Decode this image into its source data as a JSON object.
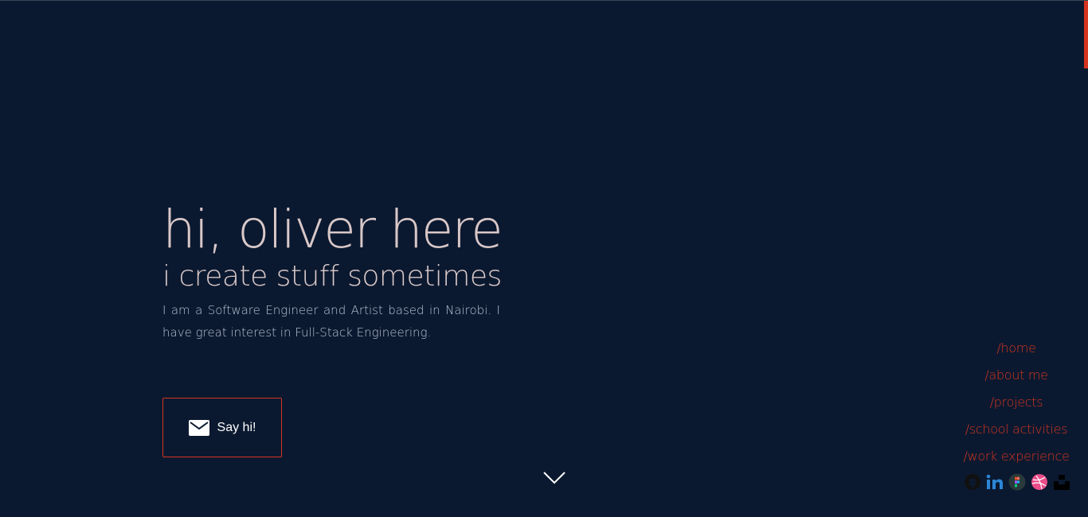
{
  "hero": {
    "title": "hi, oliver here",
    "subtitle": "i create stuff sometimes",
    "description": "I am a Software Engineer and Artist based in Nairobi. I have great interest in Full-Stack Engineering."
  },
  "cta": {
    "label": "Say hi!",
    "icon": "envelope-icon"
  },
  "scroll_down": {
    "icon": "chevron-down-icon"
  },
  "nav": {
    "items": [
      {
        "label": "/home"
      },
      {
        "label": "/about me"
      },
      {
        "label": "/projects"
      },
      {
        "label": "/school activities"
      },
      {
        "label": "/work experience"
      }
    ]
  },
  "socials": [
    {
      "icon": "github-icon"
    },
    {
      "icon": "linkedin-icon"
    },
    {
      "icon": "figma-icon"
    },
    {
      "icon": "dribbble-icon"
    },
    {
      "icon": "unsplash-icon"
    }
  ],
  "colors": {
    "background": "#0b1930",
    "accent": "#d6341f",
    "title": "#d9c8c8",
    "body_text": "#b9c2d3"
  }
}
